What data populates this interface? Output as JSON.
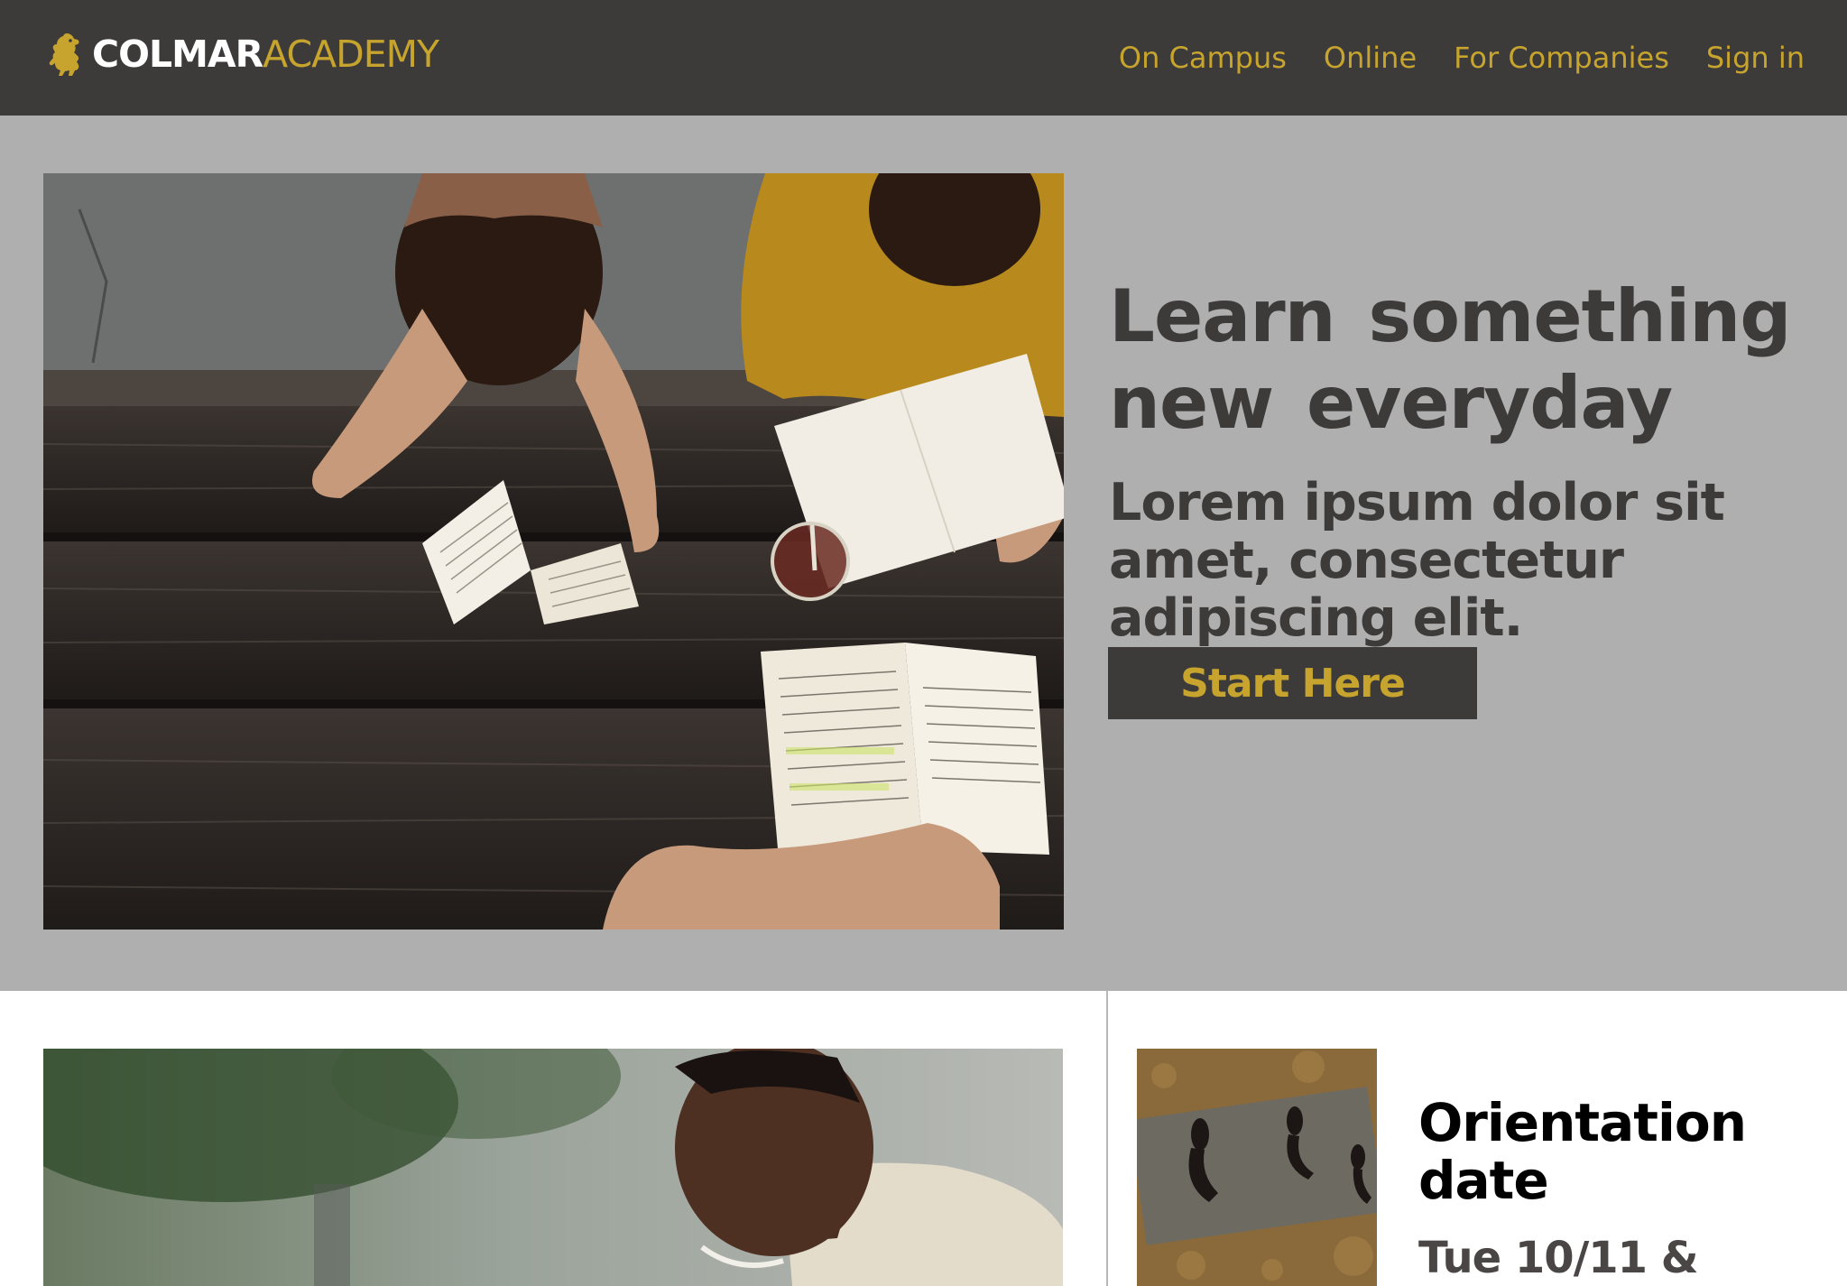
{
  "brand": {
    "name_primary": "COLMAR",
    "name_secondary": "ACADEMY"
  },
  "nav": {
    "items": [
      {
        "label": "On Campus"
      },
      {
        "label": "Online"
      },
      {
        "label": "For Companies"
      },
      {
        "label": "Sign in"
      }
    ]
  },
  "hero": {
    "title": "Learn something new everyday",
    "subtitle": "Lorem ipsum dolor sit amet, consectetur adipiscing elit.",
    "cta_label": "Start Here"
  },
  "events": {
    "title": "Orientation date",
    "date": "Tue 10/11 &"
  },
  "colors": {
    "nav_background": "#3d3a3a",
    "accent_gold": "#c6a42d",
    "hero_background": "#afafaf",
    "text_dark": "#3d3a3a"
  },
  "icons": {
    "logo": "lion-icon"
  }
}
